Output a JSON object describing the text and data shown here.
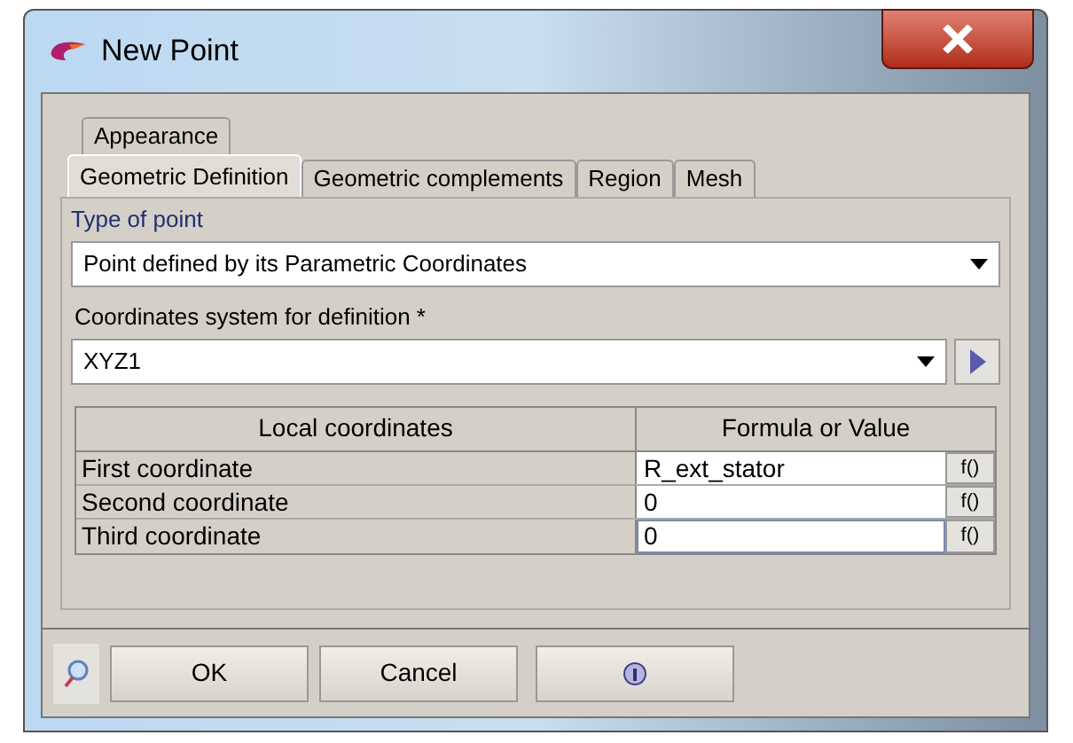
{
  "window": {
    "title": "New Point"
  },
  "tab_rows": [
    [
      {
        "label": "Appearance",
        "selected": false
      }
    ],
    [
      {
        "label": "Geometric Definition",
        "selected": true
      },
      {
        "label": "Geometric complements",
        "selected": false
      },
      {
        "label": "Region",
        "selected": false
      },
      {
        "label": "Mesh",
        "selected": false
      }
    ]
  ],
  "group": {
    "title": "Type of point",
    "type_value": "Point defined by its Parametric Coordinates",
    "system_label": "Coordinates system for definition *",
    "system_value": "XYZ1"
  },
  "table": {
    "columns": [
      "Local coordinates",
      "Formula or Value"
    ],
    "rows": [
      {
        "label": "First coordinate",
        "value": "R_ext_stator",
        "focused": false,
        "formula_button": "f()"
      },
      {
        "label": "Second coordinate",
        "value": "0",
        "focused": false,
        "formula_button": "f()"
      },
      {
        "label": "Third coordinate",
        "value": "0",
        "focused": true,
        "formula_button": "f()"
      }
    ]
  },
  "buttons": [
    "OK",
    "Cancel"
  ]
}
